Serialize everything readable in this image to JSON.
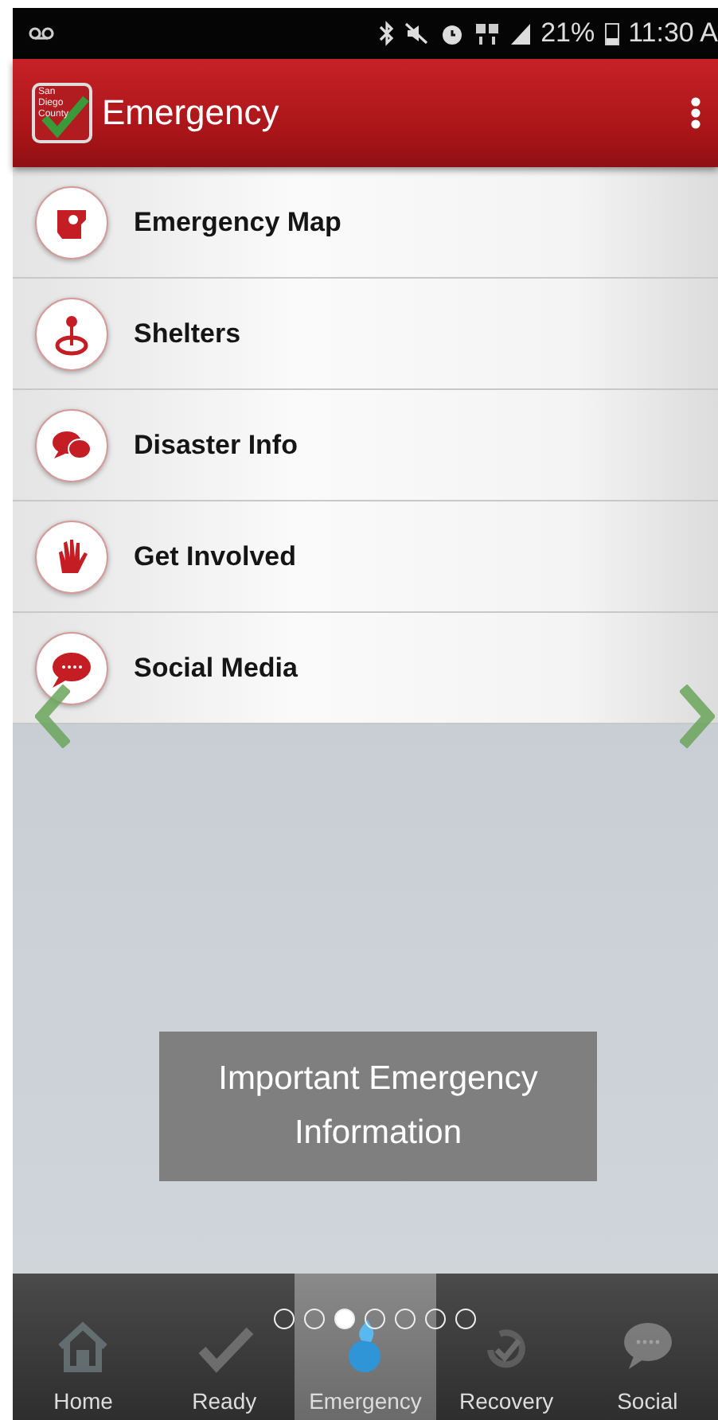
{
  "status_bar": {
    "battery": "21%",
    "time": "11:30 A"
  },
  "header": {
    "logo_text": "San Diego County",
    "title": "Emergency"
  },
  "menu": [
    {
      "label": "Emergency Map",
      "kind": "map"
    },
    {
      "label": "Shelters",
      "kind": "pin"
    },
    {
      "label": "Disaster Info",
      "kind": "chat"
    },
    {
      "label": "Get Involved",
      "kind": "hand"
    },
    {
      "label": "Social Media",
      "kind": "bubble"
    }
  ],
  "info_button": {
    "label": "Important Emergency Information"
  },
  "pager": [
    {
      "selected": false
    },
    {
      "selected": false
    },
    {
      "selected": true
    },
    {
      "selected": false
    },
    {
      "selected": false
    },
    {
      "selected": false
    },
    {
      "selected": false
    }
  ],
  "tabs": [
    {
      "label": "Home",
      "kind": "home",
      "selected": false
    },
    {
      "label": "Ready",
      "kind": "check",
      "selected": false
    },
    {
      "label": "Emergency",
      "kind": "flame",
      "selected": true
    },
    {
      "label": "Recovery",
      "kind": "recover",
      "selected": false
    },
    {
      "label": "Social",
      "kind": "chat",
      "selected": false
    }
  ]
}
